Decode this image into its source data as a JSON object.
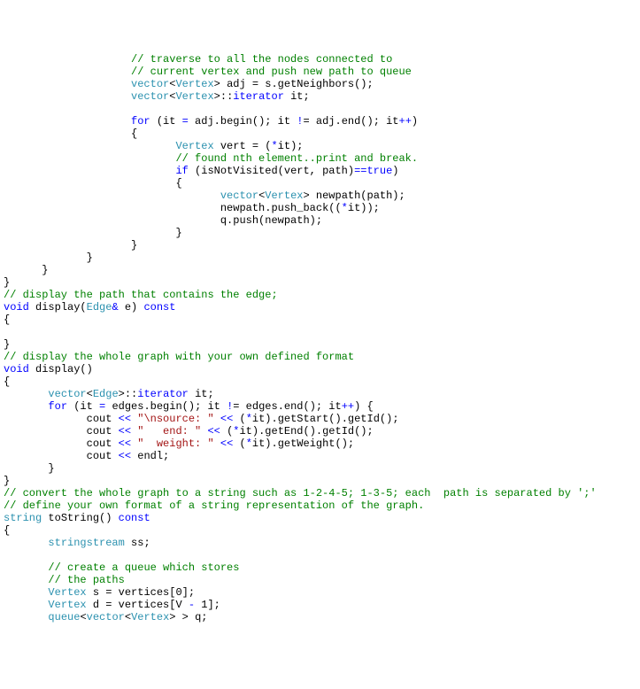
{
  "code": {
    "lines": [
      {
        "indent": "                    ",
        "segs": [
          {
            "t": "comment",
            "v": "// traverse to all the nodes connected to"
          }
        ]
      },
      {
        "indent": "                    ",
        "segs": [
          {
            "t": "comment",
            "v": "// current vertex and push new path to queue"
          }
        ]
      },
      {
        "indent": "                    ",
        "segs": [
          {
            "t": "type",
            "v": "vector"
          },
          {
            "t": "plain",
            "v": "<"
          },
          {
            "t": "type",
            "v": "Vertex"
          },
          {
            "t": "plain",
            "v": "> adj = s.getNeighbors();"
          }
        ]
      },
      {
        "indent": "                    ",
        "segs": [
          {
            "t": "type",
            "v": "vector"
          },
          {
            "t": "plain",
            "v": "<"
          },
          {
            "t": "type",
            "v": "Vertex"
          },
          {
            "t": "plain",
            "v": ">::"
          },
          {
            "t": "keyword",
            "v": "iterator"
          },
          {
            "t": "plain",
            "v": " it;"
          }
        ]
      },
      {
        "indent": "",
        "segs": []
      },
      {
        "indent": "                    ",
        "segs": [
          {
            "t": "keyword",
            "v": "for"
          },
          {
            "t": "plain",
            "v": " (it "
          },
          {
            "t": "keyword",
            "v": "="
          },
          {
            "t": "plain",
            "v": " adj.begin(); it "
          },
          {
            "t": "keyword",
            "v": "!"
          },
          {
            "t": "plain",
            "v": "= adj.end(); it"
          },
          {
            "t": "keyword",
            "v": "++"
          },
          {
            "t": "plain",
            "v": ")"
          }
        ]
      },
      {
        "indent": "                    ",
        "segs": [
          {
            "t": "plain",
            "v": "{"
          }
        ]
      },
      {
        "indent": "                           ",
        "segs": [
          {
            "t": "type",
            "v": "Vertex"
          },
          {
            "t": "plain",
            "v": " vert = ("
          },
          {
            "t": "keyword",
            "v": "*"
          },
          {
            "t": "plain",
            "v": "it);"
          }
        ]
      },
      {
        "indent": "                           ",
        "segs": [
          {
            "t": "comment",
            "v": "// found nth element..print and break."
          }
        ]
      },
      {
        "indent": "                           ",
        "segs": [
          {
            "t": "keyword",
            "v": "if"
          },
          {
            "t": "plain",
            "v": " (isNotVisited(vert, path)"
          },
          {
            "t": "keyword",
            "v": "=="
          },
          {
            "t": "keyword",
            "v": "true"
          },
          {
            "t": "plain",
            "v": ")"
          }
        ]
      },
      {
        "indent": "                           ",
        "segs": [
          {
            "t": "plain",
            "v": "{"
          }
        ]
      },
      {
        "indent": "                                  ",
        "segs": [
          {
            "t": "type",
            "v": "vector"
          },
          {
            "t": "plain",
            "v": "<"
          },
          {
            "t": "type",
            "v": "Vertex"
          },
          {
            "t": "plain",
            "v": "> newpath(path);"
          }
        ]
      },
      {
        "indent": "                                  ",
        "segs": [
          {
            "t": "plain",
            "v": "newpath.push_back(("
          },
          {
            "t": "keyword",
            "v": "*"
          },
          {
            "t": "plain",
            "v": "it));"
          }
        ]
      },
      {
        "indent": "                                  ",
        "segs": [
          {
            "t": "plain",
            "v": "q.push(newpath);"
          }
        ]
      },
      {
        "indent": "                           ",
        "segs": [
          {
            "t": "plain",
            "v": "}"
          }
        ]
      },
      {
        "indent": "                    ",
        "segs": [
          {
            "t": "plain",
            "v": "}"
          }
        ]
      },
      {
        "indent": "             ",
        "segs": [
          {
            "t": "plain",
            "v": "}"
          }
        ]
      },
      {
        "indent": "      ",
        "segs": [
          {
            "t": "plain",
            "v": "}"
          }
        ]
      },
      {
        "indent": "",
        "segs": [
          {
            "t": "plain",
            "v": "}"
          }
        ]
      },
      {
        "indent": "",
        "segs": [
          {
            "t": "comment",
            "v": "// display the path that contains the edge;"
          }
        ]
      },
      {
        "indent": "",
        "segs": [
          {
            "t": "keyword",
            "v": "void"
          },
          {
            "t": "plain",
            "v": " display("
          },
          {
            "t": "type",
            "v": "Edge"
          },
          {
            "t": "keyword",
            "v": "&"
          },
          {
            "t": "plain",
            "v": " e) "
          },
          {
            "t": "keyword",
            "v": "const"
          }
        ]
      },
      {
        "indent": "",
        "segs": [
          {
            "t": "plain",
            "v": "{"
          }
        ]
      },
      {
        "indent": "",
        "segs": []
      },
      {
        "indent": "",
        "segs": [
          {
            "t": "plain",
            "v": "}"
          }
        ]
      },
      {
        "indent": "",
        "segs": [
          {
            "t": "comment",
            "v": "// display the whole graph with your own defined format"
          }
        ]
      },
      {
        "indent": "",
        "segs": [
          {
            "t": "keyword",
            "v": "void"
          },
          {
            "t": "plain",
            "v": " display()"
          }
        ]
      },
      {
        "indent": "",
        "segs": [
          {
            "t": "plain",
            "v": "{"
          }
        ]
      },
      {
        "indent": "       ",
        "segs": [
          {
            "t": "type",
            "v": "vector"
          },
          {
            "t": "plain",
            "v": "<"
          },
          {
            "t": "type",
            "v": "Edge"
          },
          {
            "t": "plain",
            "v": ">::"
          },
          {
            "t": "keyword",
            "v": "iterator"
          },
          {
            "t": "plain",
            "v": " it;"
          }
        ]
      },
      {
        "indent": "       ",
        "segs": [
          {
            "t": "keyword",
            "v": "for"
          },
          {
            "t": "plain",
            "v": " (it "
          },
          {
            "t": "keyword",
            "v": "="
          },
          {
            "t": "plain",
            "v": " edges.begin(); it "
          },
          {
            "t": "keyword",
            "v": "!"
          },
          {
            "t": "plain",
            "v": "= edges.end(); it"
          },
          {
            "t": "keyword",
            "v": "++"
          },
          {
            "t": "plain",
            "v": ") {"
          }
        ]
      },
      {
        "indent": "             ",
        "segs": [
          {
            "t": "plain",
            "v": "cout "
          },
          {
            "t": "keyword",
            "v": "<<"
          },
          {
            "t": "plain",
            "v": " "
          },
          {
            "t": "string",
            "v": "\"\\nsource: \""
          },
          {
            "t": "plain",
            "v": " "
          },
          {
            "t": "keyword",
            "v": "<<"
          },
          {
            "t": "plain",
            "v": " ("
          },
          {
            "t": "keyword",
            "v": "*"
          },
          {
            "t": "plain",
            "v": "it).getStart().getId();"
          }
        ]
      },
      {
        "indent": "             ",
        "segs": [
          {
            "t": "plain",
            "v": "cout "
          },
          {
            "t": "keyword",
            "v": "<<"
          },
          {
            "t": "plain",
            "v": " "
          },
          {
            "t": "string",
            "v": "\"   end: \""
          },
          {
            "t": "plain",
            "v": " "
          },
          {
            "t": "keyword",
            "v": "<<"
          },
          {
            "t": "plain",
            "v": " ("
          },
          {
            "t": "keyword",
            "v": "*"
          },
          {
            "t": "plain",
            "v": "it).getEnd().getId();"
          }
        ]
      },
      {
        "indent": "             ",
        "segs": [
          {
            "t": "plain",
            "v": "cout "
          },
          {
            "t": "keyword",
            "v": "<<"
          },
          {
            "t": "plain",
            "v": " "
          },
          {
            "t": "string",
            "v": "\"  weight: \""
          },
          {
            "t": "plain",
            "v": " "
          },
          {
            "t": "keyword",
            "v": "<<"
          },
          {
            "t": "plain",
            "v": " ("
          },
          {
            "t": "keyword",
            "v": "*"
          },
          {
            "t": "plain",
            "v": "it).getWeight();"
          }
        ]
      },
      {
        "indent": "             ",
        "segs": [
          {
            "t": "plain",
            "v": "cout "
          },
          {
            "t": "keyword",
            "v": "<<"
          },
          {
            "t": "plain",
            "v": " endl;"
          }
        ]
      },
      {
        "indent": "       ",
        "segs": [
          {
            "t": "plain",
            "v": "}"
          }
        ]
      },
      {
        "indent": "",
        "segs": [
          {
            "t": "plain",
            "v": "}"
          }
        ]
      },
      {
        "indent": "",
        "segs": [
          {
            "t": "comment",
            "v": "// convert the whole graph to a string such as 1-2-4-5; 1-3-5; each  path is separated by ';'"
          }
        ]
      },
      {
        "indent": "",
        "segs": [
          {
            "t": "comment",
            "v": "// define your own format of a string representation of the graph."
          }
        ]
      },
      {
        "indent": "",
        "segs": [
          {
            "t": "type",
            "v": "string"
          },
          {
            "t": "plain",
            "v": " toString() "
          },
          {
            "t": "keyword",
            "v": "const"
          }
        ]
      },
      {
        "indent": "",
        "segs": [
          {
            "t": "plain",
            "v": "{"
          }
        ]
      },
      {
        "indent": "       ",
        "segs": [
          {
            "t": "type",
            "v": "stringstream"
          },
          {
            "t": "plain",
            "v": " ss;"
          }
        ]
      },
      {
        "indent": "",
        "segs": []
      },
      {
        "indent": "       ",
        "segs": [
          {
            "t": "comment",
            "v": "// create a queue which stores"
          }
        ]
      },
      {
        "indent": "       ",
        "segs": [
          {
            "t": "comment",
            "v": "// the paths"
          }
        ]
      },
      {
        "indent": "       ",
        "segs": [
          {
            "t": "type",
            "v": "Vertex"
          },
          {
            "t": "plain",
            "v": " s = vertices[0];"
          }
        ]
      },
      {
        "indent": "       ",
        "segs": [
          {
            "t": "type",
            "v": "Vertex"
          },
          {
            "t": "plain",
            "v": " d = vertices[V "
          },
          {
            "t": "keyword",
            "v": "-"
          },
          {
            "t": "plain",
            "v": " 1];"
          }
        ]
      },
      {
        "indent": "       ",
        "segs": [
          {
            "t": "type",
            "v": "queue"
          },
          {
            "t": "plain",
            "v": "<"
          },
          {
            "t": "type",
            "v": "vector"
          },
          {
            "t": "plain",
            "v": "<"
          },
          {
            "t": "type",
            "v": "Vertex"
          },
          {
            "t": "plain",
            "v": "> > q;"
          }
        ]
      }
    ]
  }
}
